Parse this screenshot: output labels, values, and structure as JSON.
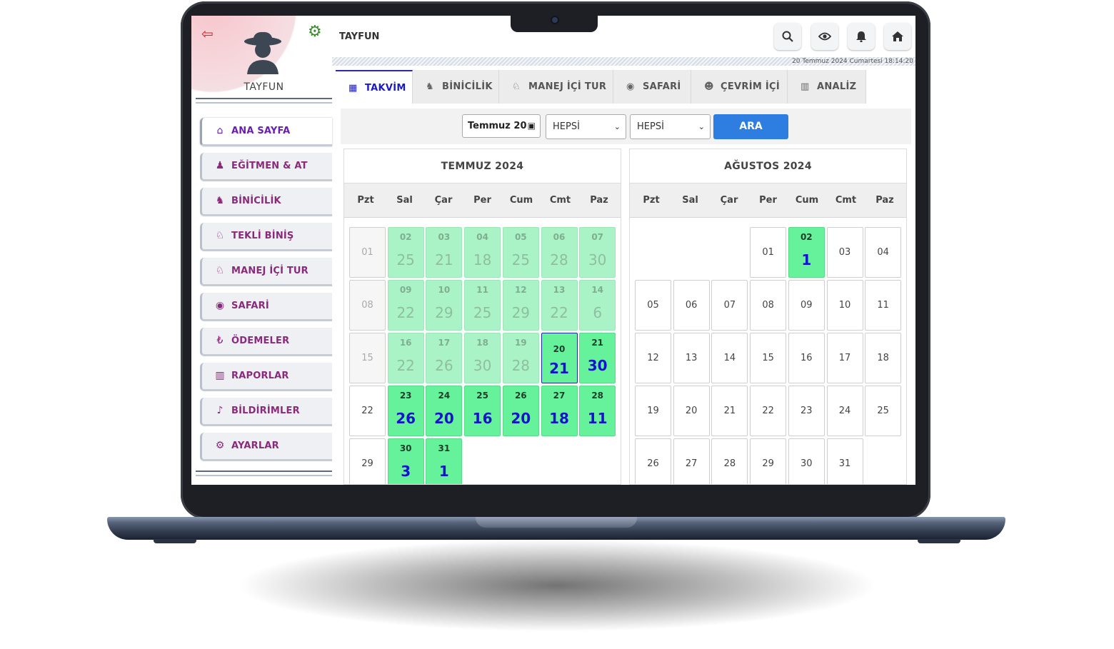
{
  "user": {
    "name": "TAYFUN"
  },
  "sidebar": {
    "items": [
      {
        "label": "ANA SAYFA",
        "icon": "home-icon"
      },
      {
        "label": "EĞİTMEN & AT",
        "icon": "trainer-icon"
      },
      {
        "label": "BİNİCİLİK",
        "icon": "horse-head-icon"
      },
      {
        "label": "TEKLİ BİNİŞ",
        "icon": "horse-icon"
      },
      {
        "label": "MANEJ İÇİ TUR",
        "icon": "horse-icon"
      },
      {
        "label": "SAFARİ",
        "icon": "compass-icon"
      },
      {
        "label": "ÖDEMELER",
        "icon": "lira-icon"
      },
      {
        "label": "RAPORLAR",
        "icon": "chart-icon"
      },
      {
        "label": "BİLDİRİMLER",
        "icon": "bell-icon"
      },
      {
        "label": "AYARLAR",
        "icon": "gear-icon"
      }
    ]
  },
  "topbar": {
    "title": "TAYFUN",
    "datetime": "20 Temmuz 2024 Cumartesi 18:14:20",
    "buttons": [
      "search-icon",
      "eye-icon",
      "bell-icon",
      "home-icon"
    ]
  },
  "tabs": [
    {
      "label": "TAKVİM",
      "icon": "calendar-icon"
    },
    {
      "label": "BİNİCİLİK",
      "icon": "horse-head-icon"
    },
    {
      "label": "MANEJ İÇİ TUR",
      "icon": "horse-icon"
    },
    {
      "label": "SAFARİ",
      "icon": "compass-icon"
    },
    {
      "label": "ÇEVRİM İÇİ",
      "icon": "users-icon"
    },
    {
      "label": "ANALİZ",
      "icon": "chart-icon"
    }
  ],
  "filter": {
    "month_value": "Temmuz 20",
    "select1": "HEPSİ",
    "select2": "HEPSİ",
    "search_button": "ARA"
  },
  "weekdays": [
    "Pzt",
    "Sal",
    "Çar",
    "Per",
    "Cum",
    "Cmt",
    "Paz"
  ],
  "calendars": [
    {
      "title": "TEMMUZ 2024",
      "weeks": [
        [
          {
            "d": "01",
            "t": "past"
          },
          {
            "d": "02",
            "c": "25",
            "t": "faded"
          },
          {
            "d": "03",
            "c": "21",
            "t": "faded"
          },
          {
            "d": "04",
            "c": "18",
            "t": "faded"
          },
          {
            "d": "05",
            "c": "25",
            "t": "faded"
          },
          {
            "d": "06",
            "c": "28",
            "t": "faded"
          },
          {
            "d": "07",
            "c": "30",
            "t": "faded"
          }
        ],
        [
          {
            "d": "08",
            "t": "past"
          },
          {
            "d": "09",
            "c": "22",
            "t": "faded"
          },
          {
            "d": "10",
            "c": "29",
            "t": "faded"
          },
          {
            "d": "11",
            "c": "25",
            "t": "faded"
          },
          {
            "d": "12",
            "c": "29",
            "t": "faded"
          },
          {
            "d": "13",
            "c": "22",
            "t": "faded"
          },
          {
            "d": "14",
            "c": "6",
            "t": "faded"
          }
        ],
        [
          {
            "d": "15",
            "t": "past"
          },
          {
            "d": "16",
            "c": "22",
            "t": "faded"
          },
          {
            "d": "17",
            "c": "26",
            "t": "faded"
          },
          {
            "d": "18",
            "c": "30",
            "t": "faded"
          },
          {
            "d": "19",
            "c": "28",
            "t": "faded"
          },
          {
            "d": "20",
            "c": "21",
            "t": "today"
          },
          {
            "d": "21",
            "c": "30",
            "t": "green"
          }
        ],
        [
          {
            "d": "22",
            "t": "plain"
          },
          {
            "d": "23",
            "c": "26",
            "t": "green"
          },
          {
            "d": "24",
            "c": "20",
            "t": "green"
          },
          {
            "d": "25",
            "c": "16",
            "t": "green"
          },
          {
            "d": "26",
            "c": "20",
            "t": "green"
          },
          {
            "d": "27",
            "c": "18",
            "t": "green"
          },
          {
            "d": "28",
            "c": "11",
            "t": "green"
          }
        ],
        [
          {
            "d": "29",
            "t": "plain"
          },
          {
            "d": "30",
            "c": "3",
            "t": "green"
          },
          {
            "d": "31",
            "c": "1",
            "t": "green"
          },
          null,
          null,
          null,
          null
        ]
      ]
    },
    {
      "title": "AĞUSTOS 2024",
      "weeks": [
        [
          null,
          null,
          null,
          {
            "d": "01",
            "t": "plain"
          },
          {
            "d": "02",
            "c": "1",
            "t": "green"
          },
          {
            "d": "03",
            "t": "plain"
          },
          {
            "d": "04",
            "t": "plain"
          }
        ],
        [
          {
            "d": "05",
            "t": "plain"
          },
          {
            "d": "06",
            "t": "plain"
          },
          {
            "d": "07",
            "t": "plain"
          },
          {
            "d": "08",
            "t": "plain"
          },
          {
            "d": "09",
            "t": "plain"
          },
          {
            "d": "10",
            "t": "plain"
          },
          {
            "d": "11",
            "t": "plain"
          }
        ],
        [
          {
            "d": "12",
            "t": "plain"
          },
          {
            "d": "13",
            "t": "plain"
          },
          {
            "d": "14",
            "t": "plain"
          },
          {
            "d": "15",
            "t": "plain"
          },
          {
            "d": "16",
            "t": "plain"
          },
          {
            "d": "17",
            "t": "plain"
          },
          {
            "d": "18",
            "t": "plain"
          }
        ],
        [
          {
            "d": "19",
            "t": "plain"
          },
          {
            "d": "20",
            "t": "plain"
          },
          {
            "d": "21",
            "t": "plain"
          },
          {
            "d": "22",
            "t": "plain"
          },
          {
            "d": "23",
            "t": "plain"
          },
          {
            "d": "24",
            "t": "plain"
          },
          {
            "d": "25",
            "t": "plain"
          }
        ],
        [
          {
            "d": "26",
            "t": "plain"
          },
          {
            "d": "27",
            "t": "plain"
          },
          {
            "d": "28",
            "t": "plain"
          },
          {
            "d": "29",
            "t": "plain"
          },
          {
            "d": "30",
            "t": "plain"
          },
          {
            "d": "31",
            "t": "plain"
          },
          null
        ]
      ]
    }
  ],
  "colors": {
    "accent": "#8a2a7a",
    "active_tab": "#1a1ac8",
    "green": "#66f29a",
    "button": "#2d7ee0"
  }
}
